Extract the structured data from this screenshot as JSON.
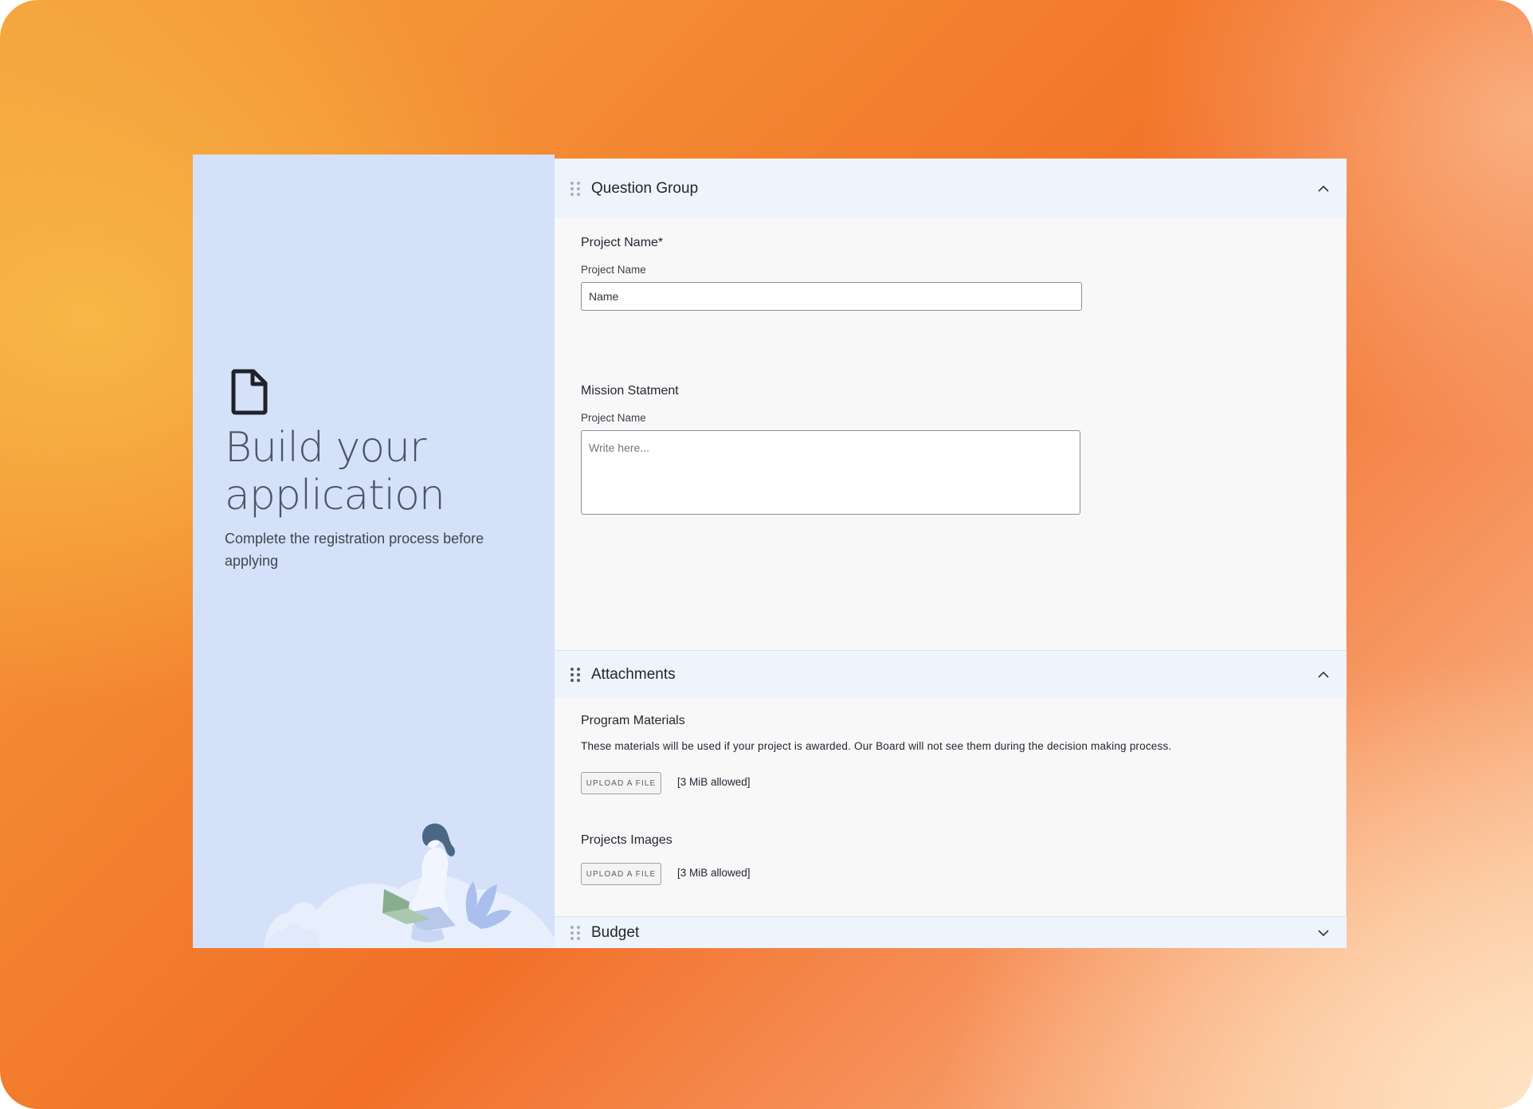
{
  "hero": {
    "title": "Build your application",
    "subtitle": "Complete the registration process before applying",
    "icon": "document-icon"
  },
  "sections": {
    "question_group": {
      "title": "Question Group",
      "expanded": true,
      "project_name": {
        "heading": "Project Name*",
        "label": "Project Name",
        "value": "Name"
      },
      "mission": {
        "heading": "Mission Statment",
        "label": "Project Name",
        "placeholder": "Write here..."
      }
    },
    "attachments": {
      "title": "Attachments",
      "expanded": true,
      "program_materials": {
        "heading": "Program Materials",
        "help": "These materials will be used if your project is awarded. Our Board will not see them during the decision making process.",
        "upload_label": "UPLOAD A FILE",
        "limit": "[3 MiB allowed]"
      },
      "project_images": {
        "heading": "Projects Images",
        "upload_label": "UPLOAD A FILE",
        "limit": "[3 MiB allowed]"
      }
    },
    "budget": {
      "title": "Budget",
      "expanded": false
    }
  },
  "colors": {
    "left_panel": "#d5e1f8",
    "section_header": "#eef4fd",
    "content_bg": "#f8f8f8"
  }
}
